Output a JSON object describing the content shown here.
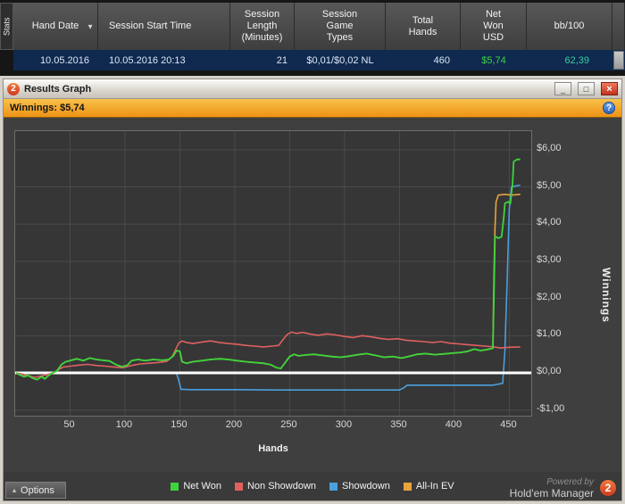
{
  "colors": {
    "net_won_value": "#3dd24b",
    "bb100_value": "#38cfa0",
    "winnings_bar": "#f2a024",
    "selected_row": "#10294e",
    "close_button": "#c0311c"
  },
  "table": {
    "stats_tab_label": "Stats",
    "sort_arrow": "▼",
    "columns": [
      {
        "label": "Hand Date"
      },
      {
        "label": "Session Start Time"
      },
      {
        "label": "Session Length (Minutes)"
      },
      {
        "label": "Session Game Types"
      },
      {
        "label": "Total Hands"
      },
      {
        "label": "Net Won USD"
      },
      {
        "label": "bb/100"
      }
    ],
    "row": {
      "hand_date": "10.05.2016",
      "session_start_time": "10.05.2016 20:13",
      "session_length": "21",
      "session_game_types": "$0,01/$0,02 NL",
      "total_hands": "460",
      "net_won_usd": "$5,74",
      "bb_100": "62,39"
    }
  },
  "window": {
    "title": "Results Graph",
    "icon_text": "2",
    "controls": {
      "minimize": "_",
      "maximize": "□",
      "close": "×"
    }
  },
  "winnings_bar": {
    "label": "Winnings: $5,74",
    "help": "?"
  },
  "footer": {
    "options_label": "Options",
    "options_arrow": "▴",
    "powered_by": "Powered by",
    "brand": "Hold'em Manager",
    "brand_badge": "2"
  },
  "chart_data": {
    "type": "line",
    "title": "",
    "xlabel": "Hands",
    "ylabel": "Winnings",
    "xlim": [
      0,
      470
    ],
    "ylim": [
      -1.15,
      6.5
    ],
    "x_ticks": [
      50,
      100,
      150,
      200,
      250,
      300,
      350,
      400,
      450
    ],
    "y_ticks": [
      {
        "value": 6,
        "label": "$6,00"
      },
      {
        "value": 5,
        "label": "$5,00"
      },
      {
        "value": 4,
        "label": "$4,00"
      },
      {
        "value": 3,
        "label": "$3,00"
      },
      {
        "value": 2,
        "label": "$2,00"
      },
      {
        "value": 1,
        "label": "$1,00"
      },
      {
        "value": 0,
        "label": "$0,00"
      },
      {
        "value": -1,
        "label": "-$1,00"
      }
    ],
    "grid": true,
    "grid_color": "#4a4a4a",
    "zero_line": {
      "value": 0,
      "color": "#ffffff",
      "width": 3
    },
    "legend_position": "bottom",
    "series": [
      {
        "name": "Net Won",
        "color": "#3dd43d",
        "points": [
          [
            1,
            0
          ],
          [
            4,
            -0.05
          ],
          [
            8,
            -0.1
          ],
          [
            12,
            -0.07
          ],
          [
            16,
            -0.14
          ],
          [
            20,
            -0.18
          ],
          [
            24,
            -0.1
          ],
          [
            27,
            -0.16
          ],
          [
            30,
            -0.08
          ],
          [
            34,
            0
          ],
          [
            38,
            0.05
          ],
          [
            42,
            0.22
          ],
          [
            46,
            0.3
          ],
          [
            50,
            0.33
          ],
          [
            56,
            0.38
          ],
          [
            62,
            0.33
          ],
          [
            68,
            0.4
          ],
          [
            74,
            0.36
          ],
          [
            80,
            0.34
          ],
          [
            86,
            0.32
          ],
          [
            92,
            0.22
          ],
          [
            97,
            0.17
          ],
          [
            102,
            0.2
          ],
          [
            106,
            0.33
          ],
          [
            112,
            0.36
          ],
          [
            118,
            0.33
          ],
          [
            126,
            0.36
          ],
          [
            134,
            0.34
          ],
          [
            140,
            0.36
          ],
          [
            144,
            0.46
          ],
          [
            147,
            0.6
          ],
          [
            150,
            0.58
          ],
          [
            152,
            0.3
          ],
          [
            156,
            0.26
          ],
          [
            162,
            0.3
          ],
          [
            170,
            0.33
          ],
          [
            178,
            0.36
          ],
          [
            186,
            0.38
          ],
          [
            194,
            0.36
          ],
          [
            202,
            0.33
          ],
          [
            210,
            0.3
          ],
          [
            218,
            0.28
          ],
          [
            226,
            0.26
          ],
          [
            233,
            0.22
          ],
          [
            238,
            0.14
          ],
          [
            242,
            0.12
          ],
          [
            246,
            0.28
          ],
          [
            250,
            0.44
          ],
          [
            254,
            0.5
          ],
          [
            258,
            0.46
          ],
          [
            264,
            0.48
          ],
          [
            272,
            0.5
          ],
          [
            280,
            0.47
          ],
          [
            288,
            0.44
          ],
          [
            296,
            0.42
          ],
          [
            304,
            0.45
          ],
          [
            312,
            0.49
          ],
          [
            320,
            0.52
          ],
          [
            328,
            0.47
          ],
          [
            336,
            0.42
          ],
          [
            344,
            0.44
          ],
          [
            352,
            0.4
          ],
          [
            358,
            0.44
          ],
          [
            366,
            0.5
          ],
          [
            374,
            0.52
          ],
          [
            382,
            0.49
          ],
          [
            390,
            0.51
          ],
          [
            398,
            0.53
          ],
          [
            406,
            0.55
          ],
          [
            412,
            0.58
          ],
          [
            418,
            0.64
          ],
          [
            424,
            0.6
          ],
          [
            430,
            0.63
          ],
          [
            435,
            0.66
          ],
          [
            436,
            2.0
          ],
          [
            437,
            3.68
          ],
          [
            440,
            3.62
          ],
          [
            443,
            3.66
          ],
          [
            445,
            4.2
          ],
          [
            446,
            4.56
          ],
          [
            449,
            4.6
          ],
          [
            451,
            4.55
          ],
          [
            453,
            5.1
          ],
          [
            454,
            5.68
          ],
          [
            457,
            5.74
          ],
          [
            460,
            5.74
          ]
        ]
      },
      {
        "name": "Non Showdown",
        "color": "#e06060",
        "points": [
          [
            1,
            0
          ],
          [
            6,
            -0.03
          ],
          [
            12,
            -0.08
          ],
          [
            18,
            -0.12
          ],
          [
            24,
            -0.08
          ],
          [
            30,
            -0.04
          ],
          [
            36,
            0.02
          ],
          [
            40,
            0.1
          ],
          [
            44,
            0.16
          ],
          [
            50,
            0.18
          ],
          [
            58,
            0.21
          ],
          [
            66,
            0.23
          ],
          [
            74,
            0.2
          ],
          [
            82,
            0.18
          ],
          [
            90,
            0.16
          ],
          [
            98,
            0.14
          ],
          [
            106,
            0.2
          ],
          [
            114,
            0.24
          ],
          [
            122,
            0.26
          ],
          [
            130,
            0.28
          ],
          [
            138,
            0.31
          ],
          [
            143,
            0.44
          ],
          [
            146,
            0.62
          ],
          [
            149,
            0.8
          ],
          [
            152,
            0.86
          ],
          [
            156,
            0.82
          ],
          [
            162,
            0.79
          ],
          [
            170,
            0.83
          ],
          [
            178,
            0.86
          ],
          [
            186,
            0.82
          ],
          [
            194,
            0.79
          ],
          [
            202,
            0.77
          ],
          [
            210,
            0.74
          ],
          [
            218,
            0.72
          ],
          [
            226,
            0.7
          ],
          [
            234,
            0.72
          ],
          [
            240,
            0.74
          ],
          [
            244,
            0.9
          ],
          [
            248,
            1.04
          ],
          [
            252,
            1.1
          ],
          [
            256,
            1.06
          ],
          [
            262,
            1.09
          ],
          [
            268,
            1.05
          ],
          [
            276,
            1.01
          ],
          [
            284,
            1.05
          ],
          [
            292,
            1.02
          ],
          [
            300,
            0.98
          ],
          [
            308,
            0.95
          ],
          [
            316,
            1.0
          ],
          [
            324,
            0.97
          ],
          [
            332,
            0.93
          ],
          [
            340,
            0.9
          ],
          [
            348,
            0.92
          ],
          [
            356,
            0.88
          ],
          [
            364,
            0.86
          ],
          [
            372,
            0.84
          ],
          [
            380,
            0.82
          ],
          [
            388,
            0.84
          ],
          [
            396,
            0.8
          ],
          [
            404,
            0.78
          ],
          [
            412,
            0.76
          ],
          [
            420,
            0.74
          ],
          [
            428,
            0.72
          ],
          [
            436,
            0.7
          ],
          [
            442,
            0.67
          ],
          [
            450,
            0.69
          ],
          [
            460,
            0.7
          ]
        ]
      },
      {
        "name": "Showdown",
        "color": "#4a9fdd",
        "points": [
          [
            1,
            0
          ],
          [
            50,
            0
          ],
          [
            100,
            0
          ],
          [
            140,
            0
          ],
          [
            147,
            -0.02
          ],
          [
            149,
            -0.2
          ],
          [
            151,
            -0.44
          ],
          [
            160,
            -0.45
          ],
          [
            200,
            -0.45
          ],
          [
            240,
            -0.46
          ],
          [
            280,
            -0.46
          ],
          [
            320,
            -0.46
          ],
          [
            350,
            -0.46
          ],
          [
            354,
            -0.4
          ],
          [
            357,
            -0.33
          ],
          [
            380,
            -0.33
          ],
          [
            410,
            -0.33
          ],
          [
            435,
            -0.33
          ],
          [
            440,
            -0.3
          ],
          [
            444,
            -0.28
          ],
          [
            446,
            0.6
          ],
          [
            448,
            2.4
          ],
          [
            450,
            4.4
          ],
          [
            452,
            5.0
          ],
          [
            455,
            5.02
          ],
          [
            460,
            5.05
          ]
        ]
      },
      {
        "name": "All-In EV",
        "color": "#e8a33c",
        "points": [
          [
            1,
            0
          ],
          [
            4,
            -0.05
          ],
          [
            8,
            -0.1
          ],
          [
            12,
            -0.07
          ],
          [
            16,
            -0.14
          ],
          [
            20,
            -0.18
          ],
          [
            24,
            -0.1
          ],
          [
            27,
            -0.16
          ],
          [
            30,
            -0.08
          ],
          [
            34,
            0
          ],
          [
            38,
            0.05
          ],
          [
            42,
            0.22
          ],
          [
            46,
            0.3
          ],
          [
            50,
            0.33
          ],
          [
            56,
            0.38
          ],
          [
            62,
            0.33
          ],
          [
            68,
            0.4
          ],
          [
            74,
            0.36
          ],
          [
            80,
            0.34
          ],
          [
            86,
            0.32
          ],
          [
            92,
            0.22
          ],
          [
            97,
            0.17
          ],
          [
            102,
            0.2
          ],
          [
            106,
            0.33
          ],
          [
            112,
            0.36
          ],
          [
            118,
            0.33
          ],
          [
            126,
            0.36
          ],
          [
            134,
            0.34
          ],
          [
            140,
            0.36
          ],
          [
            144,
            0.46
          ],
          [
            147,
            0.6
          ],
          [
            150,
            0.58
          ],
          [
            152,
            0.3
          ],
          [
            156,
            0.26
          ],
          [
            162,
            0.3
          ],
          [
            170,
            0.33
          ],
          [
            178,
            0.36
          ],
          [
            186,
            0.38
          ],
          [
            194,
            0.36
          ],
          [
            202,
            0.33
          ],
          [
            210,
            0.3
          ],
          [
            218,
            0.28
          ],
          [
            226,
            0.26
          ],
          [
            233,
            0.22
          ],
          [
            238,
            0.14
          ],
          [
            242,
            0.12
          ],
          [
            246,
            0.28
          ],
          [
            250,
            0.44
          ],
          [
            254,
            0.5
          ],
          [
            258,
            0.46
          ],
          [
            264,
            0.48
          ],
          [
            272,
            0.5
          ],
          [
            280,
            0.47
          ],
          [
            288,
            0.44
          ],
          [
            296,
            0.42
          ],
          [
            304,
            0.45
          ],
          [
            312,
            0.49
          ],
          [
            320,
            0.52
          ],
          [
            328,
            0.47
          ],
          [
            336,
            0.42
          ],
          [
            344,
            0.44
          ],
          [
            352,
            0.4
          ],
          [
            358,
            0.44
          ],
          [
            366,
            0.5
          ],
          [
            374,
            0.52
          ],
          [
            382,
            0.49
          ],
          [
            390,
            0.51
          ],
          [
            398,
            0.53
          ],
          [
            406,
            0.55
          ],
          [
            412,
            0.58
          ],
          [
            418,
            0.64
          ],
          [
            424,
            0.6
          ],
          [
            430,
            0.63
          ],
          [
            435,
            0.66
          ],
          [
            436,
            2.6
          ],
          [
            437,
            3.9
          ],
          [
            438,
            4.6
          ],
          [
            440,
            4.78
          ],
          [
            446,
            4.8
          ],
          [
            452,
            4.78
          ],
          [
            460,
            4.8
          ]
        ]
      }
    ]
  }
}
